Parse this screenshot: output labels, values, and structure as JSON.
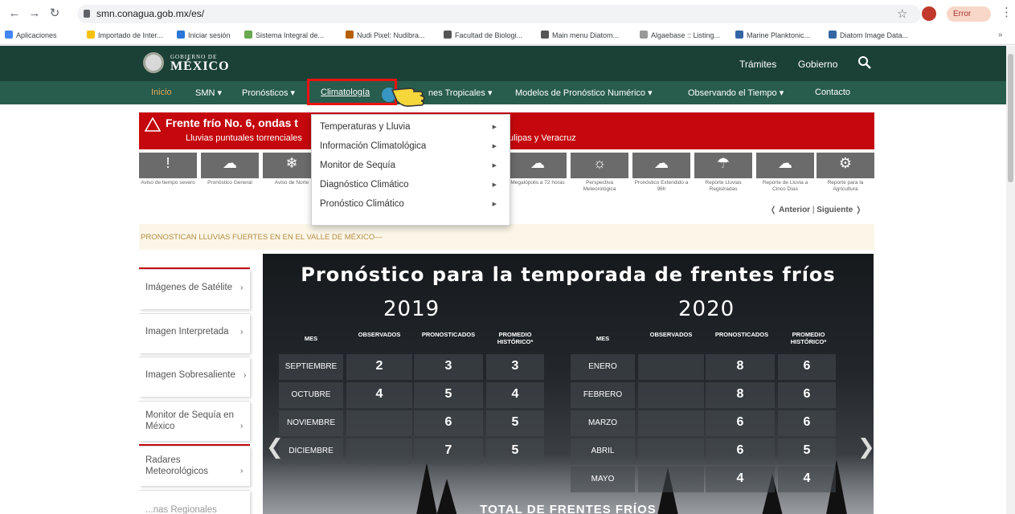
{
  "browser": {
    "url": "smn.conagua.gob.mx/es/",
    "error_pill": "Error",
    "bookmarks": [
      {
        "label": "Aplicaciones",
        "color": "#4285f4"
      },
      {
        "label": "Importado de Inter...",
        "color": "#f4c20d"
      },
      {
        "label": "Iniciar sesión",
        "color": "#2b76d6"
      },
      {
        "label": "Sistema Integral de...",
        "color": "#6aa84f"
      },
      {
        "label": "Nudi Pixel: Nudibra...",
        "color": "#b45f06"
      },
      {
        "label": "Facultad de Biologi...",
        "color": "#555555"
      },
      {
        "label": "Main menu Diatom...",
        "color": "#555555"
      },
      {
        "label": "Algaebase :: Listing...",
        "color": "#999999"
      },
      {
        "label": "Marine Planktonic...",
        "color": "#3465a4"
      },
      {
        "label": "Diatom Image Data...",
        "color": "#3465a4"
      }
    ]
  },
  "header": {
    "logo_small": "GOBIERNO DE",
    "logo_big": "MÉXICO",
    "tramites": "Trámites",
    "gobierno": "Gobierno"
  },
  "menu": {
    "inicio": "Inicio",
    "smn": "SMN",
    "pronosticos": "Pronósticos",
    "climatologia": "Climatología",
    "ciclones": "nes Tropicales",
    "modelos": "Modelos de Pronóstico Numérico",
    "observando": "Observando el Tiempo",
    "contacto": "Contacto"
  },
  "alert": {
    "title": "Frente frío No. 6, ondas t",
    "subtitle": "Lluvias puntuales torrenciales",
    "subtitle_end": "ulipas y Veracruz"
  },
  "services": [
    {
      "glyph": "!",
      "label": "Aviso de tiempo severo"
    },
    {
      "glyph": "☁",
      "label": "Pronóstico General"
    },
    {
      "glyph": "❄",
      "label": "Aviso de Norte"
    },
    {
      "glyph": "☁",
      "label": "Megalópolis a 72 horas"
    },
    {
      "glyph": "☼",
      "label": "Perspectiva Meteorológica"
    },
    {
      "glyph": "☁",
      "label": "Pronóstico Extendido a 96h"
    },
    {
      "glyph": "☂",
      "label": "Reporte Lluvias Registradas"
    },
    {
      "glyph": "☁",
      "label": "Reporte de Lluvia a Cinco Días"
    },
    {
      "glyph": "⚙",
      "label": "Reporte para la Agricultura"
    }
  ],
  "pager": {
    "prev": "Anterior",
    "sep": "|",
    "next": "Siguiente"
  },
  "ticker": "PRONOSTICAN LLUVIAS FUERTES EN EN EL VALLE DE MÉXICO—",
  "sidebar": [
    {
      "label": "Imágenes de Satélite"
    },
    {
      "label": "Imagen Interpretada"
    },
    {
      "label": "Imagen Sobresaliente"
    },
    {
      "label": "Monitor de Sequía en",
      "label2": "México"
    },
    {
      "label": "Radares",
      "label2": "Meteorológicos"
    },
    {
      "label": "...nas Regionales"
    }
  ],
  "dropdown": [
    "Temperaturas y Lluvia",
    "Información Climatológica",
    "Monitor de Sequía",
    "Diagnóstico Climático",
    "Pronóstico Climático"
  ],
  "hero": {
    "title": "Pronóstico para la temporada de frentes fríos",
    "year_left": "2019",
    "year_right": "2020",
    "headers": {
      "mes": "MES",
      "observados": "OBSERVADOS",
      "pronosticados": "PRONOSTICADOS",
      "promedio1": "PROMEDIO",
      "promedio2": "HISTÓRICO*"
    },
    "left_rows": [
      {
        "mes": "SEPTIEMBRE",
        "obs": "2",
        "pron": "3",
        "prom": "3"
      },
      {
        "mes": "OCTUBRE",
        "obs": "4",
        "pron": "5",
        "prom": "4"
      },
      {
        "mes": "NOVIEMBRE",
        "obs": "",
        "pron": "6",
        "prom": "5"
      },
      {
        "mes": "DICIEMBRE",
        "obs": "",
        "pron": "7",
        "prom": "5"
      }
    ],
    "right_rows": [
      {
        "mes": "ENERO",
        "obs": "",
        "pron": "8",
        "prom": "6"
      },
      {
        "mes": "FEBRERO",
        "obs": "",
        "pron": "8",
        "prom": "6"
      },
      {
        "mes": "MARZO",
        "obs": "",
        "pron": "6",
        "prom": "6"
      },
      {
        "mes": "ABRIL",
        "obs": "",
        "pron": "6",
        "prom": "5"
      },
      {
        "mes": "MAYO",
        "obs": "",
        "pron": "4",
        "prom": "4"
      }
    ],
    "footer": "TOTAL DE FRENTES FRÍOS"
  },
  "colors": {
    "header_green": "#1b4136",
    "menu_green": "#285c4d",
    "alert_red": "#c4080d",
    "accent_gold": "#b78c43"
  }
}
